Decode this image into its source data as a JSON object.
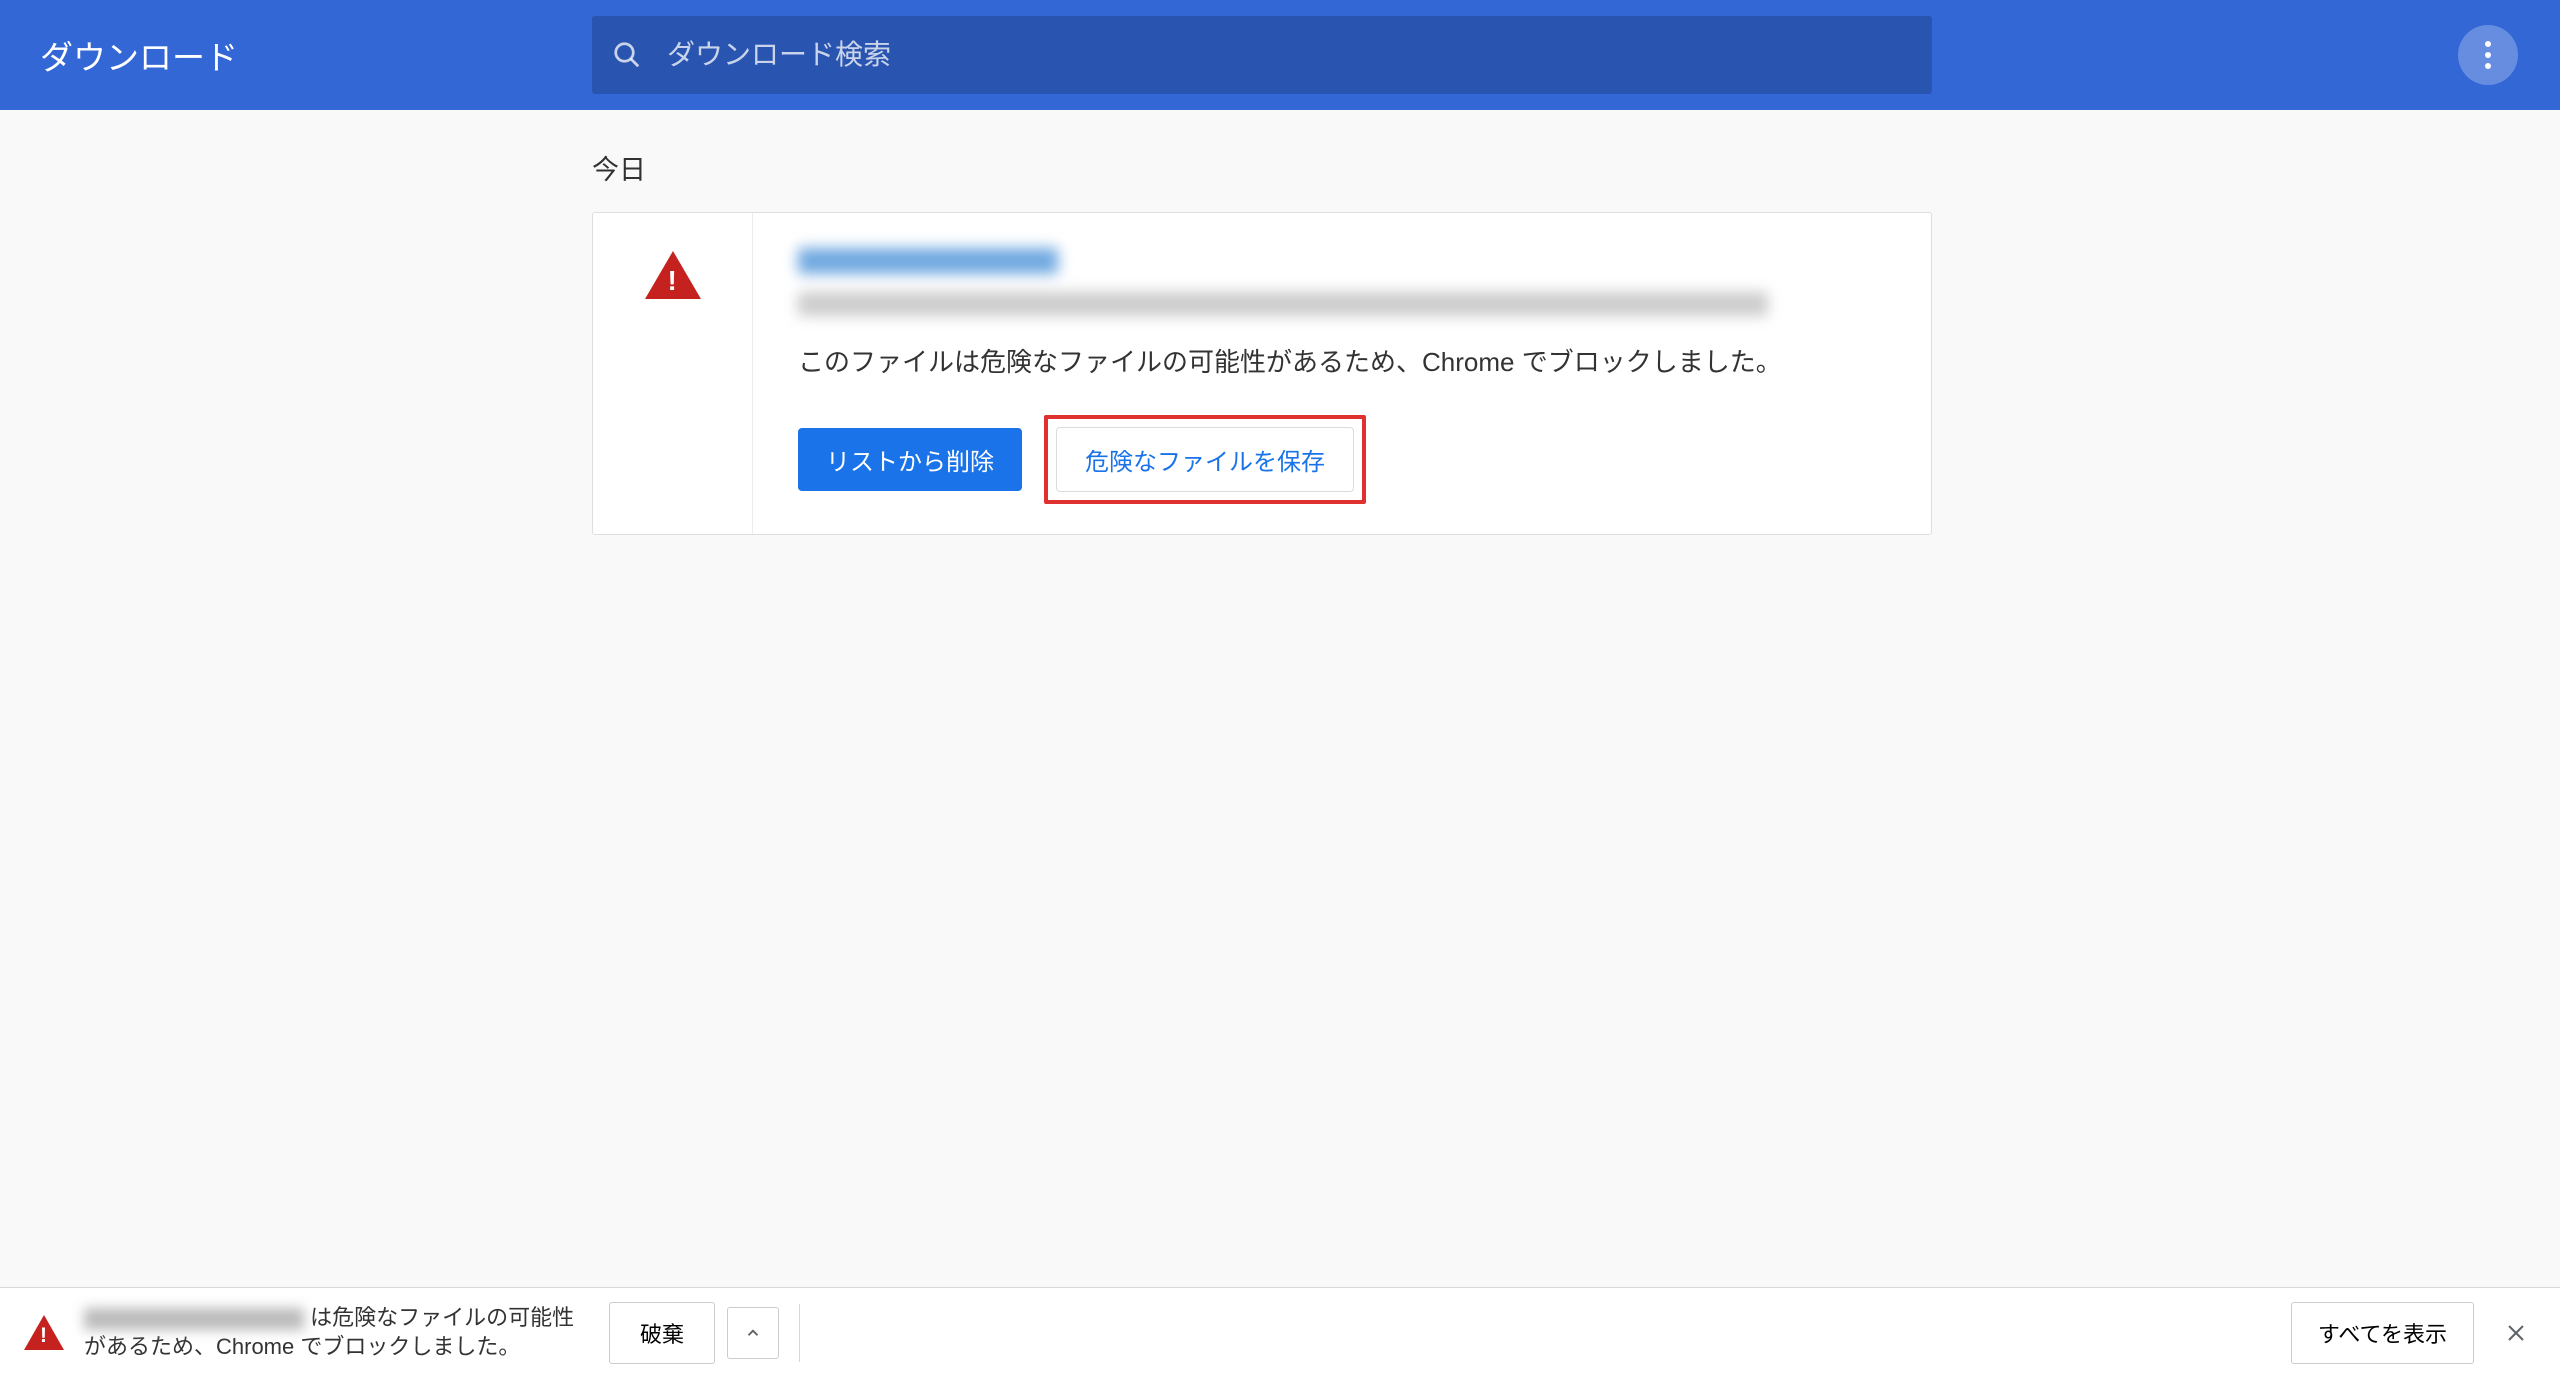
{
  "header": {
    "title": "ダウンロード",
    "search_placeholder": "ダウンロード検索"
  },
  "content": {
    "date_label": "今日",
    "download_item": {
      "warning_text": "このファイルは危険なファイルの可能性があるため、Chrome でブロックしました。",
      "remove_label": "リストから削除",
      "keep_label": "危険なファイルを保存"
    }
  },
  "bottom_bar": {
    "warning_text": "は危険なファイルの可能性があるため、Chrome でブロックしました。",
    "discard_label": "破棄",
    "show_all_label": "すべてを表示"
  },
  "colors": {
    "header_bg": "#3367d6",
    "primary_blue": "#1a73e8",
    "danger_red": "#c5221f",
    "highlight_red": "#e03131"
  }
}
